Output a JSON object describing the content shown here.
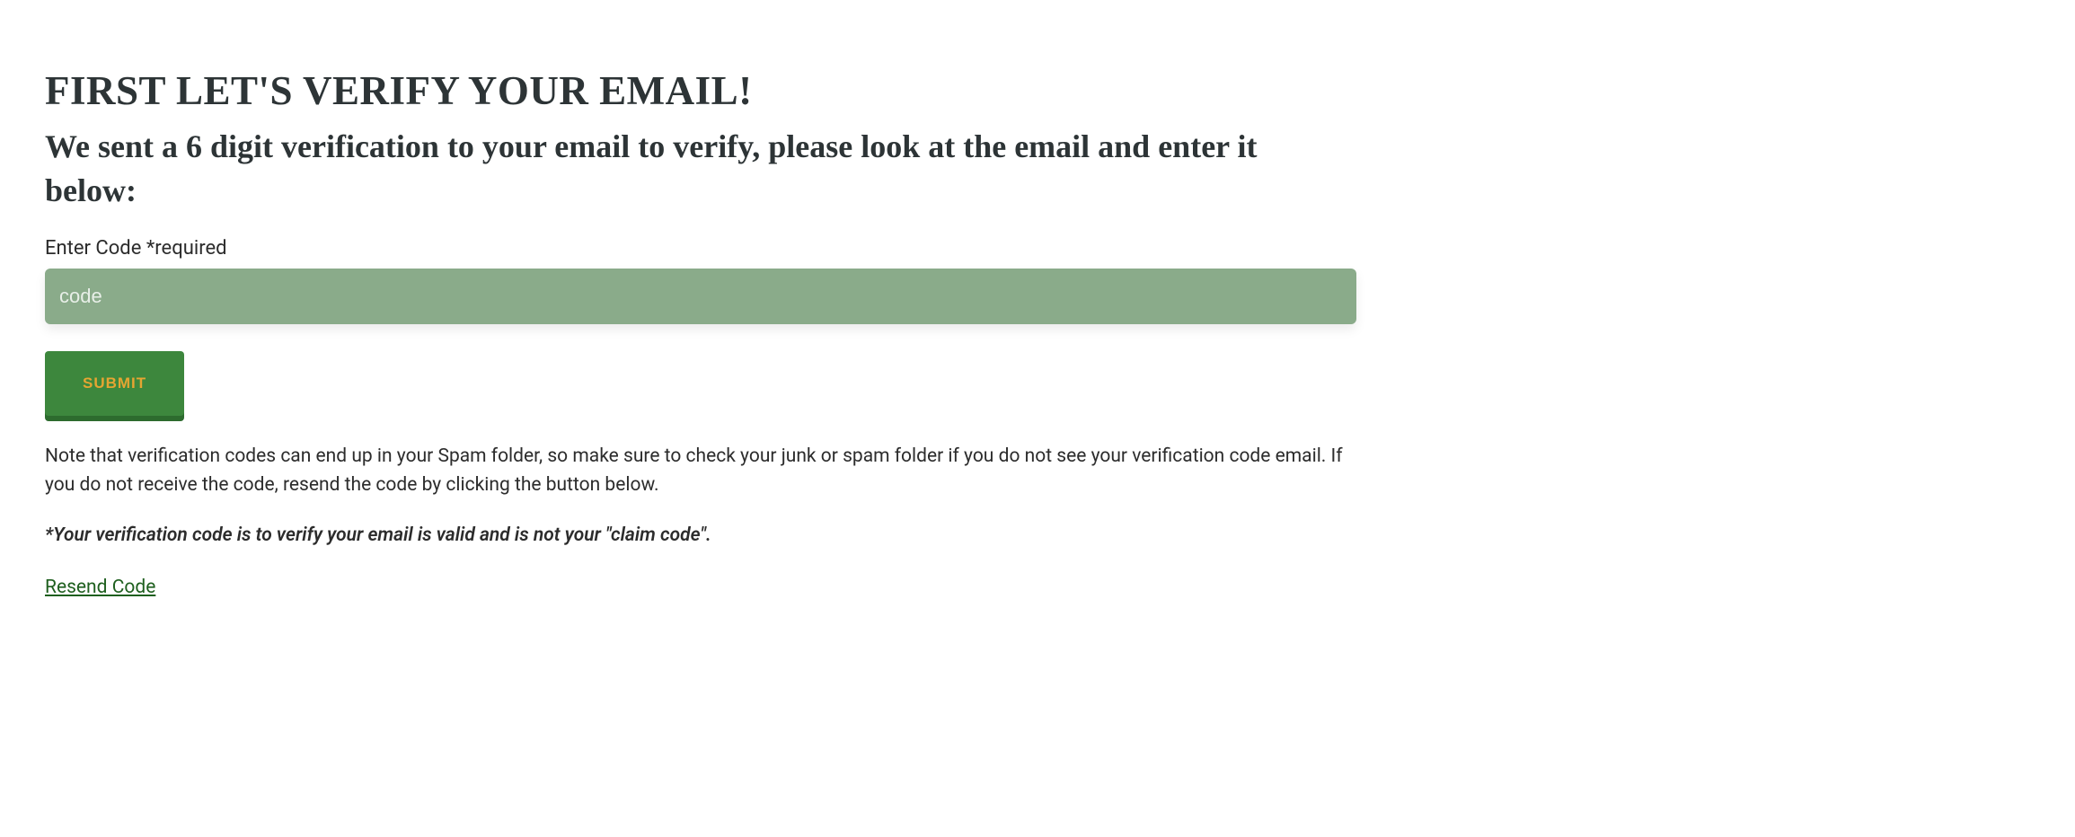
{
  "heading": {
    "main": "FIRST LET'S VERIFY YOUR EMAIL!",
    "sub": "We sent a 6 digit verification to your email to verify, please look at the email and enter it below:"
  },
  "form": {
    "code_label": "Enter Code *required",
    "code_placeholder": "code",
    "submit_label": "SUBMIT"
  },
  "messages": {
    "note": "Note that verification codes can end up in your Spam folder, so make sure to check your junk or spam folder if you do not see your verification code email. If you do not receive the code, resend the code by clicking the button below.",
    "disclaimer": "*Your verification code is to verify your email is valid and is not your \"claim code\"."
  },
  "actions": {
    "resend_label": "Resend Code"
  },
  "colors": {
    "input_bg": "#8aab8a",
    "button_bg": "#3d873d",
    "button_text": "#e6a532",
    "link": "#1e5f1e"
  }
}
